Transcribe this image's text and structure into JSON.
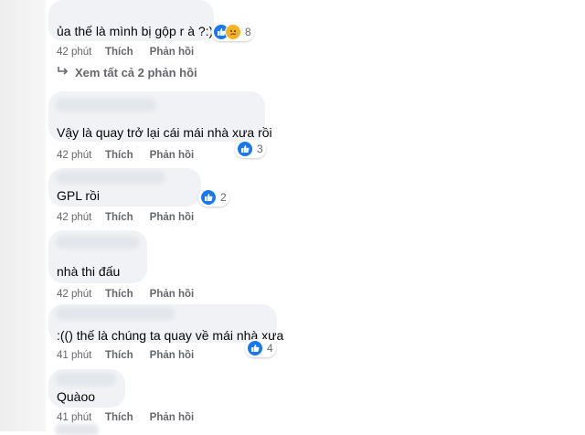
{
  "comments": [
    {
      "text": "ủa thế là mình bị gộp r à ?:))",
      "reaction_count": "8",
      "time": "42 phút"
    },
    {
      "text": "Vậy là quay trở lại cái mái nhà xưa rồi",
      "reaction_count": "3",
      "time": "42 phút"
    },
    {
      "text": "GPL rồi",
      "reaction_count": "2",
      "time": "42 phút"
    },
    {
      "text": "nhà thi đấu",
      "time": "42 phút"
    },
    {
      "text": ":(() thế là chúng ta quay về mái nhà xưa",
      "reaction_count": "4",
      "time": "41 phút"
    },
    {
      "text": "Quàoo",
      "time": "41 phút"
    }
  ],
  "actions": {
    "like": "Thích",
    "reply": "Phản hồi"
  },
  "view_replies": "Xem tất cả 2 phản hồi",
  "colors": {
    "bubble": "#f0f2f5",
    "meta": "#65676b",
    "like": "#1877f2",
    "sad": "#f7b125"
  },
  "icons": {
    "like": "like-icon",
    "sad": "sad-icon",
    "reply_arrow": "reply-arrow-icon"
  }
}
